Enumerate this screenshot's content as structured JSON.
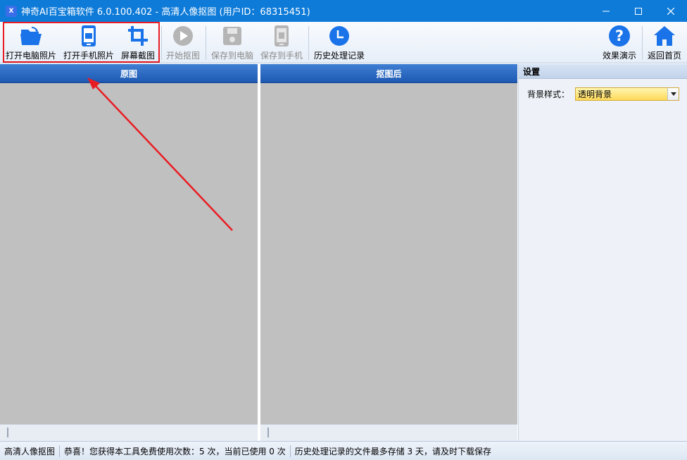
{
  "window": {
    "title": "神奇AI百宝箱软件 6.0.100.402 - 高清人像抠图 (用户ID：68315451)",
    "app_icon_text": "X",
    "controls": [
      "minimize-icon",
      "maximize-icon",
      "close-icon"
    ]
  },
  "toolbar": {
    "open_pc": "打开电脑照片",
    "open_phone": "打开手机照片",
    "screenshot": "屏幕截图",
    "start_cutout": "开始抠图",
    "save_pc": "保存到电脑",
    "save_phone": "保存到手机",
    "history": "历史处理记录",
    "demo": "效果演示",
    "home": "返回首页"
  },
  "panels": {
    "original_title": "原图",
    "result_title": "抠图后"
  },
  "settings": {
    "header": "设置",
    "bg_style_label": "背景样式：",
    "bg_style_value": "透明背景"
  },
  "status": {
    "mode": "高清人像抠图",
    "usage": "恭喜！您获得本工具免费使用次数：5 次，当前已使用 0 次",
    "notice": "历史处理记录的文件最多存储 3 天，请及时下载保存"
  },
  "colors": {
    "titlebar": "#0e7bd9",
    "accent_blue": "#1a73e8",
    "annotation_red": "#e81d23",
    "panel_bg": "#c0c0c0",
    "disabled_icon": "#b5b5b5"
  }
}
